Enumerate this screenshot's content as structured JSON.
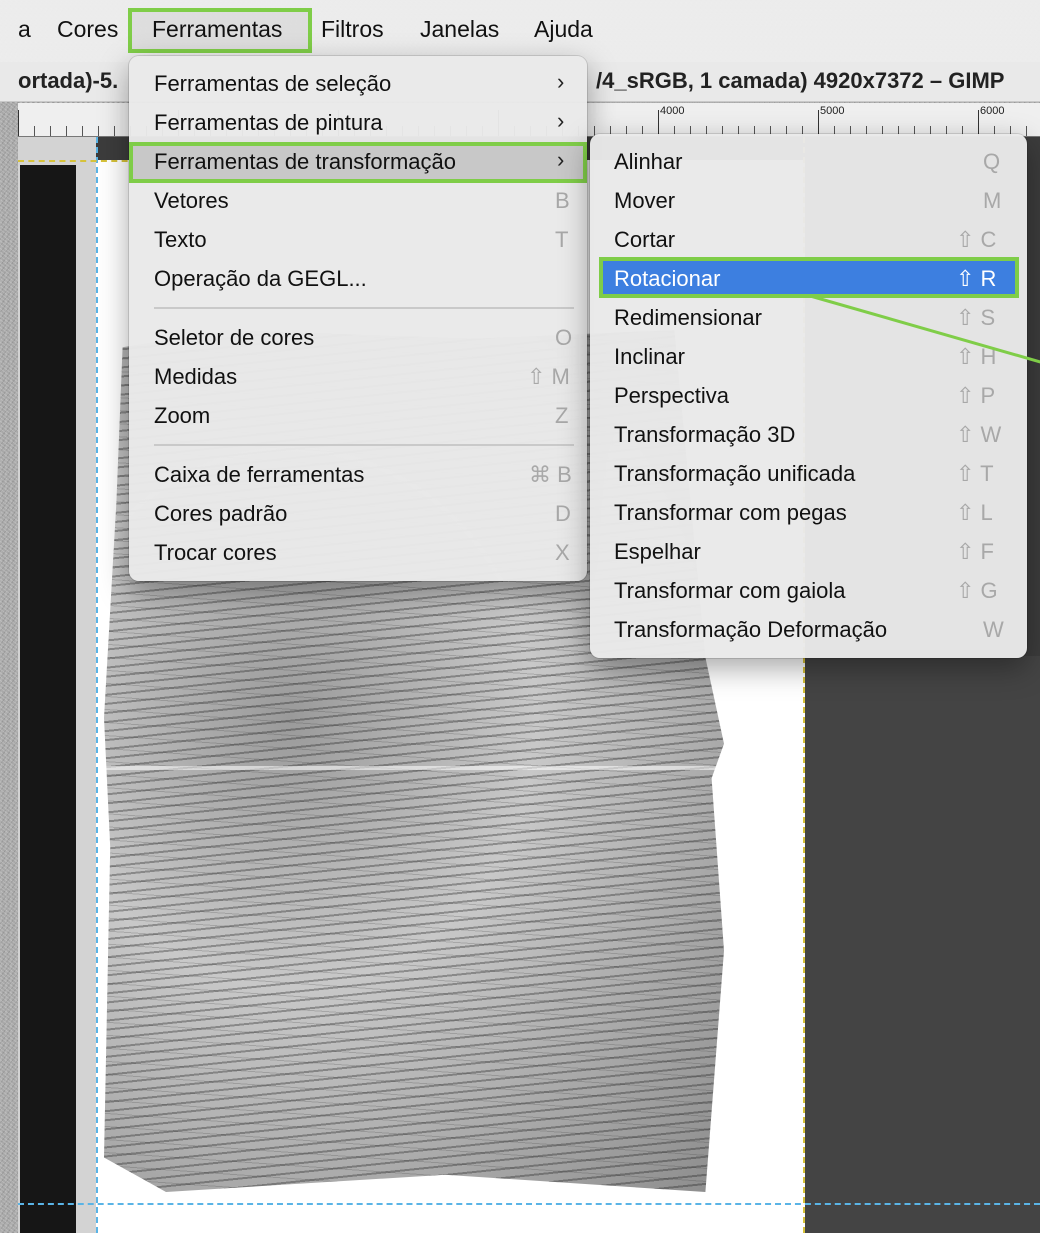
{
  "menubar": {
    "items": [
      "a",
      "Cores",
      "Ferramentas",
      "Filtros",
      "Janelas",
      "Ajuda"
    ]
  },
  "titlebar": {
    "left": "ortada)-5.",
    "right": "/4_sRGB, 1 camada) 4920x7372 – GIMP"
  },
  "ruler": {
    "labels": [
      "4000",
      "5000",
      "6000"
    ]
  },
  "menu_main": {
    "items": [
      {
        "label": "Ferramentas de seleção",
        "shortcut": "",
        "submenu": true
      },
      {
        "label": "Ferramentas de pintura",
        "shortcut": "",
        "submenu": true
      },
      {
        "label": "Ferramentas de transformação",
        "shortcut": "",
        "submenu": true
      },
      {
        "label": "Vetores",
        "shortcut": "B"
      },
      {
        "label": "Texto",
        "shortcut": "T"
      },
      {
        "label": "Operação da GEGL...",
        "shortcut": ""
      },
      {
        "label": "Seletor de cores",
        "shortcut": "O"
      },
      {
        "label": "Medidas",
        "shortcut": "⇧ M"
      },
      {
        "label": "Zoom",
        "shortcut": "Z"
      },
      {
        "label": "Caixa de ferramentas",
        "shortcut": "⌘ B"
      },
      {
        "label": "Cores padrão",
        "shortcut": "D"
      },
      {
        "label": "Trocar cores",
        "shortcut": "X"
      }
    ]
  },
  "menu_sub": {
    "items": [
      {
        "label": "Alinhar",
        "shortcut": "Q"
      },
      {
        "label": "Mover",
        "shortcut": "M"
      },
      {
        "label": "Cortar",
        "shortcut": "⇧ C"
      },
      {
        "label": "Rotacionar",
        "shortcut": "⇧ R"
      },
      {
        "label": "Redimensionar",
        "shortcut": "⇧ S"
      },
      {
        "label": "Inclinar",
        "shortcut": "⇧ H"
      },
      {
        "label": "Perspectiva",
        "shortcut": "⇧ P"
      },
      {
        "label": "Transformação 3D",
        "shortcut": "⇧ W"
      },
      {
        "label": "Transformação unificada",
        "shortcut": "⇧ T"
      },
      {
        "label": "Transformar com pegas",
        "shortcut": "⇧ L"
      },
      {
        "label": "Espelhar",
        "shortcut": "⇧ F"
      },
      {
        "label": "Transformar com gaiola",
        "shortcut": "⇧ G"
      },
      {
        "label": "Transformação Deformação",
        "shortcut": "W"
      }
    ]
  },
  "colors": {
    "highlight_green": "#7fcd48",
    "selection_blue": "#3d7fe0",
    "guide_blue": "#5ab4e6"
  }
}
